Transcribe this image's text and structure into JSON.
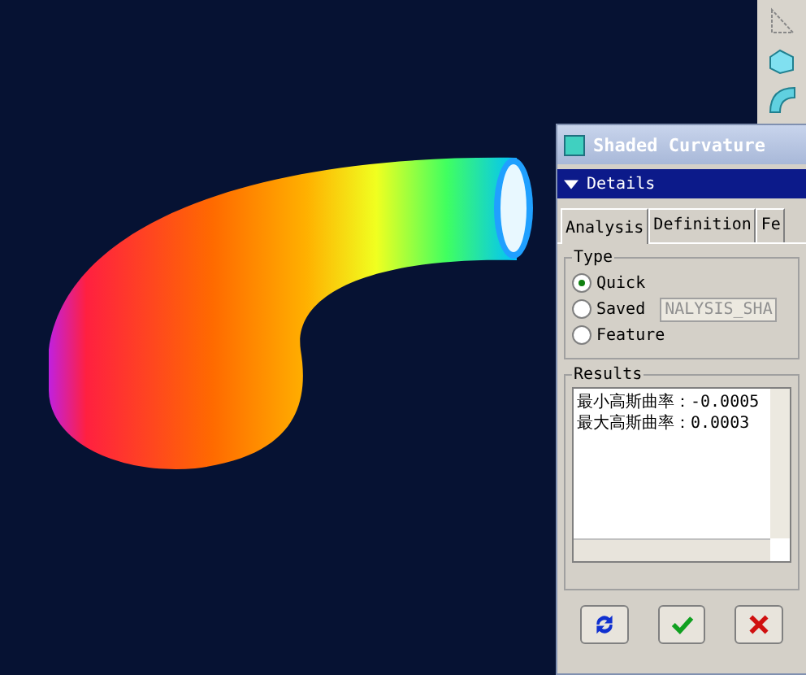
{
  "dialog": {
    "title": "Shaded Curvature",
    "section": {
      "title": "Details",
      "expanded": true
    },
    "tabs": [
      {
        "label": "Analysis",
        "selected": true
      },
      {
        "label": "Definition",
        "selected": false
      },
      {
        "label": "Fe",
        "selected": false
      }
    ],
    "type_group": {
      "label": "Type",
      "options": [
        {
          "label": "Quick",
          "selected": true
        },
        {
          "label": "Saved",
          "selected": false
        },
        {
          "label": "Feature",
          "selected": false
        }
      ],
      "name_field": {
        "value": "NALYSIS_SHA",
        "disabled": true
      }
    },
    "results": {
      "label": "Results",
      "lines": [
        "最小高斯曲率：-0.0005",
        "最大高斯曲率：0.0003"
      ]
    },
    "buttons": [
      {
        "kind": "repeat"
      },
      {
        "kind": "ok"
      },
      {
        "kind": "cancel"
      }
    ]
  }
}
